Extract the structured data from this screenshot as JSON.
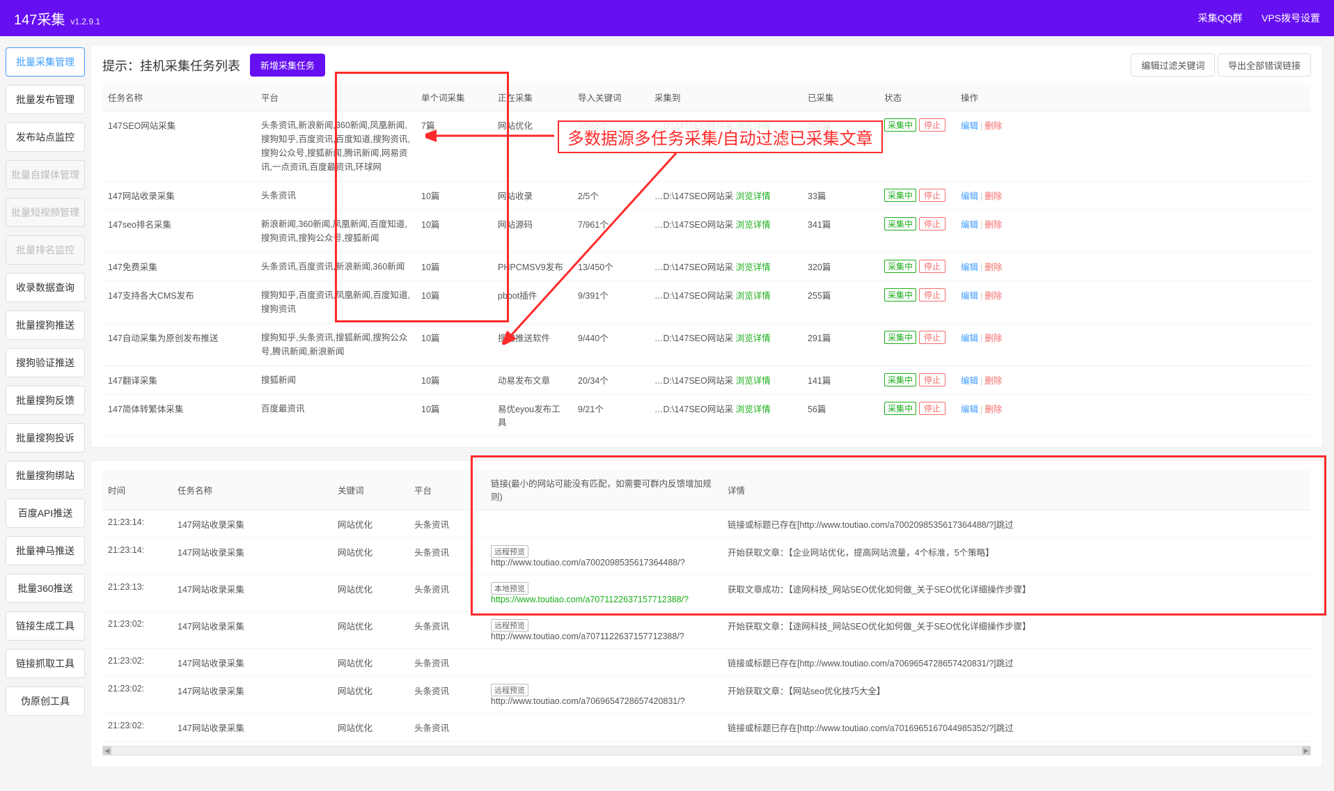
{
  "header": {
    "title": "147采集",
    "version": "v1.2.9.1",
    "links": {
      "qq": "采集QQ群",
      "vps": "VPS拨号设置"
    }
  },
  "sidebar": {
    "items": [
      {
        "label": "批量采集管理",
        "state": "active"
      },
      {
        "label": "批量发布管理",
        "state": ""
      },
      {
        "label": "发布站点监控",
        "state": ""
      },
      {
        "label": "批量自媒体管理",
        "state": "disabled"
      },
      {
        "label": "批量短视频管理",
        "state": "disabled"
      },
      {
        "label": "批量排名监控",
        "state": "disabled"
      },
      {
        "label": "收录数据查询",
        "state": ""
      },
      {
        "label": "批量搜狗推送",
        "state": ""
      },
      {
        "label": "搜狗验证推送",
        "state": ""
      },
      {
        "label": "批量搜狗反馈",
        "state": ""
      },
      {
        "label": "批量搜狗投诉",
        "state": ""
      },
      {
        "label": "批量搜狗绑站",
        "state": ""
      },
      {
        "label": "百度API推送",
        "state": ""
      },
      {
        "label": "批量神马推送",
        "state": ""
      },
      {
        "label": "批量360推送",
        "state": ""
      },
      {
        "label": "链接生成工具",
        "state": ""
      },
      {
        "label": "链接抓取工具",
        "state": ""
      },
      {
        "label": "伪原创工具",
        "state": ""
      }
    ]
  },
  "tasks": {
    "title": "提示：挂机采集任务列表",
    "new_btn": "新增采集任务",
    "filter_btn": "编辑过滤关键词",
    "export_btn": "导出全部错误链接",
    "headers": {
      "name": "任务名称",
      "platform": "平台",
      "single": "单个词采集",
      "now": "正在采集",
      "import": "导入关键词",
      "dest": "采集到",
      "collected": "已采集",
      "status": "状态",
      "op": "操作"
    },
    "detail_link": "浏览详情",
    "status_text": "采集中",
    "stop_text": "停止",
    "edit_text": "编辑",
    "del_text": "删除",
    "rows": [
      {
        "name": "147SEO网站采集",
        "platform": "头条资讯,新浪新闻,360新闻,凤凰新闻,搜狗知乎,百度资讯,百度知道,搜狗资讯,搜狗公众号,搜狐新闻,腾讯新闻,网易资讯,一点资讯,百度最资讯,环球网",
        "single": "7篇",
        "now": "网站优化",
        "import": "7/968个",
        "dest": "…D:\\147SEO网站采",
        "collected": "260篇"
      },
      {
        "name": "147网站收录采集",
        "platform": "头条资讯",
        "single": "10篇",
        "now": "网站收录",
        "import": "2/5个",
        "dest": "…D:\\147SEO网站采",
        "collected": "33篇"
      },
      {
        "name": "147seo排名采集",
        "platform": "新浪新闻,360新闻,凤凰新闻,百度知道,搜狗资讯,搜狗公众号,搜狐新闻",
        "single": "10篇",
        "now": "网站源码",
        "import": "7/961个",
        "dest": "…D:\\147SEO网站采",
        "collected": "341篇"
      },
      {
        "name": "147免费采集",
        "platform": "头条资讯,百度资讯,新浪新闻,360新闻",
        "single": "10篇",
        "now": "PHPCMSV9发布",
        "import": "13/450个",
        "dest": "…D:\\147SEO网站采",
        "collected": "320篇"
      },
      {
        "name": "147支持各大CMS发布",
        "platform": "搜狗知乎,百度资讯,凤凰新闻,百度知道,搜狗资讯",
        "single": "10篇",
        "now": "pboot插件",
        "import": "9/391个",
        "dest": "…D:\\147SEO网站采",
        "collected": "255篇"
      },
      {
        "name": "147自动采集为原创发布推送",
        "platform": "搜狗知乎,头条资讯,搜狐新闻,搜狗公众号,腾讯新闻,新浪新闻",
        "single": "10篇",
        "now": "搜狗推送软件",
        "import": "9/440个",
        "dest": "…D:\\147SEO网站采",
        "collected": "291篇"
      },
      {
        "name": "147翻译采集",
        "platform": "搜狐新闻",
        "single": "10篇",
        "now": "动易发布文章",
        "import": "20/34个",
        "dest": "…D:\\147SEO网站采",
        "collected": "141篇"
      },
      {
        "name": "147简体转繁体采集",
        "platform": "百度最资讯",
        "single": "10篇",
        "now": "易优eyou发布工具",
        "import": "9/21个",
        "dest": "…D:\\147SEO网站采",
        "collected": "56篇"
      }
    ]
  },
  "log": {
    "headers": {
      "time": "时间",
      "task": "任务名称",
      "keyword": "关键词",
      "platform": "平台",
      "link": "链接(最小的网站可能没有匹配，如需要可群内反馈增加规则)",
      "detail": "详情"
    },
    "tag_remote": "远程预览",
    "tag_local": "本地预览",
    "rows": [
      {
        "time": "21:23:14:",
        "task": "147网站收录采集",
        "keyword": "网站优化",
        "platform": "头条资讯",
        "link_tag": "",
        "link": "",
        "detail": "链接或标题已存在[http://www.toutiao.com/a7002098535617364488/?]跳过"
      },
      {
        "time": "21:23:14:",
        "task": "147网站收录采集",
        "keyword": "网站优化",
        "platform": "头条资讯",
        "link_tag": "remote",
        "link": "http://www.toutiao.com/a7002098535617364488/?",
        "detail": "开始获取文章：【企业网站优化，提高网站流量，4个标准，5个策略】"
      },
      {
        "time": "21:23:13:",
        "task": "147网站收录采集",
        "keyword": "网站优化",
        "platform": "头条资讯",
        "link_tag": "local",
        "link": "https://www.toutiao.com/a7071122637157712388/?",
        "detail": "获取文章成功：【途网科技_网站SEO优化如何做_关于SEO优化详细操作步骤】"
      },
      {
        "time": "21:23:02:",
        "task": "147网站收录采集",
        "keyword": "网站优化",
        "platform": "头条资讯",
        "link_tag": "remote",
        "link": "http://www.toutiao.com/a7071122637157712388/?",
        "detail": "开始获取文章：【途网科技_网站SEO优化如何做_关于SEO优化详细操作步骤】"
      },
      {
        "time": "21:23:02:",
        "task": "147网站收录采集",
        "keyword": "网站优化",
        "platform": "头条资讯",
        "link_tag": "",
        "link": "",
        "detail": "链接或标题已存在[http://www.toutiao.com/a7069654728657420831/?]跳过"
      },
      {
        "time": "21:23:02:",
        "task": "147网站收录采集",
        "keyword": "网站优化",
        "platform": "头条资讯",
        "link_tag": "remote",
        "link": "http://www.toutiao.com/a7069654728657420831/?",
        "detail": "开始获取文章：【网站seo优化技巧大全】"
      },
      {
        "time": "21:23:02:",
        "task": "147网站收录采集",
        "keyword": "网站优化",
        "platform": "头条资讯",
        "link_tag": "",
        "link": "",
        "detail": "链接或标题已存在[http://www.toutiao.com/a7016965167044985352/?]跳过"
      }
    ]
  },
  "annotation": {
    "text": "多数据源多任务采集/自动过滤已采集文章"
  }
}
